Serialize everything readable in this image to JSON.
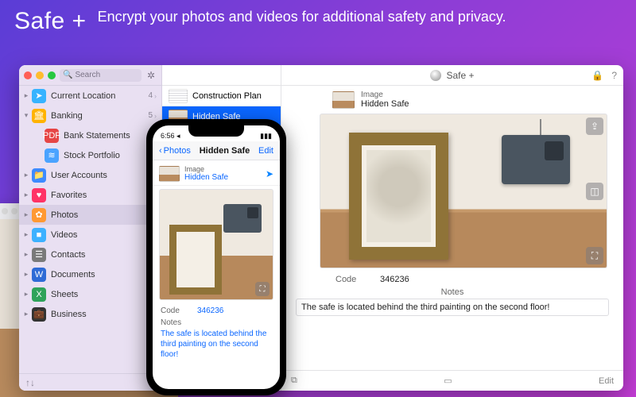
{
  "hero": {
    "app_name": "Safe +",
    "tagline": "Encrypt your photos and videos for additional safety and privacy."
  },
  "window": {
    "search_placeholder": "Search",
    "title": "Safe +",
    "sidebar_footer_icon": "↑↓",
    "toolbar": {
      "lock_icon": "lock-icon",
      "help_icon": "?"
    },
    "footer": {
      "copy_icon": "⧉",
      "archive_icon": "▭",
      "edit_label": "Edit"
    }
  },
  "sidebar": [
    {
      "icon": "location",
      "color": "#36b3ff",
      "label": "Current Location",
      "count": "4",
      "disclose": ">",
      "child": false
    },
    {
      "icon": "bank",
      "color": "#ffb300",
      "label": "Banking",
      "count": "5",
      "disclose": "v",
      "child": false
    },
    {
      "icon": "pdf",
      "color": "#e64545",
      "label": "Bank Statements",
      "count": "",
      "disclose": "",
      "child": true
    },
    {
      "icon": "stocks",
      "color": "#4aa3ff",
      "label": "Stock Portfolio",
      "count": "",
      "disclose": "",
      "child": true
    },
    {
      "icon": "users",
      "color": "#3d8bff",
      "label": "User Accounts",
      "count": "",
      "disclose": ">",
      "child": false
    },
    {
      "icon": "heart",
      "color": "#ff3366",
      "label": "Favorites",
      "count": "",
      "disclose": ">",
      "child": false
    },
    {
      "icon": "photos",
      "color": "#ff9933",
      "label": "Photos",
      "count": "",
      "disclose": ">",
      "child": false,
      "selected": true
    },
    {
      "icon": "video",
      "color": "#3db1ff",
      "label": "Videos",
      "count": "",
      "disclose": ">",
      "child": false
    },
    {
      "icon": "contacts",
      "color": "#7a7a7a",
      "label": "Contacts",
      "count": "",
      "disclose": ">",
      "child": false
    },
    {
      "icon": "doc",
      "color": "#2f6bd6",
      "label": "Documents",
      "count": "",
      "disclose": ">",
      "child": false
    },
    {
      "icon": "sheet",
      "color": "#2fa35a",
      "label": "Sheets",
      "count": "",
      "disclose": ">",
      "child": false
    },
    {
      "icon": "briefcase",
      "color": "#333333",
      "label": "Business",
      "count": "",
      "disclose": ">",
      "child": false
    }
  ],
  "items": [
    {
      "label": "Construction Plan",
      "selected": false,
      "thumb": "plan"
    },
    {
      "label": "Hidden Safe",
      "selected": true,
      "thumb": "safe"
    }
  ],
  "detail": {
    "type_label": "Image",
    "name": "Hidden Safe",
    "code_label": "Code",
    "code_value": "346236",
    "notes_label": "Notes",
    "notes_value": "The safe is located behind the third painting on the second floor!"
  },
  "phone": {
    "time": "6:56 ◂",
    "back_label": "Photos",
    "title": "Hidden Safe",
    "edit_label": "Edit",
    "type_label": "Image",
    "name": "Hidden Safe",
    "code_label": "Code",
    "code_value": "346236",
    "notes_label": "Notes",
    "notes_value": "The safe is located behind the third painting on the second floor!"
  }
}
